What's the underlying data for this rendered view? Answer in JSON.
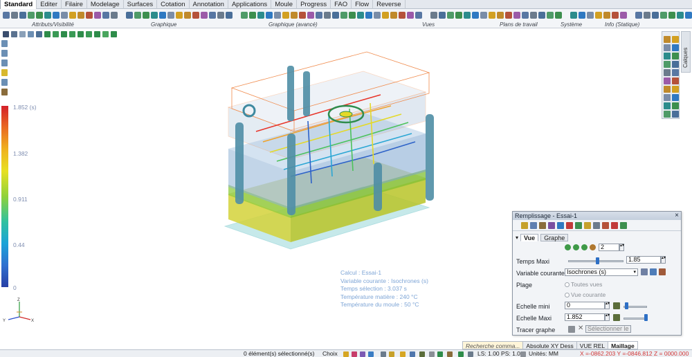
{
  "ribbon": {
    "tabs": [
      "Standard",
      "Editer",
      "Filaire",
      "Modelage",
      "Surfaces",
      "Cotation",
      "Annotation",
      "Applications",
      "Moule",
      "Progress",
      "FAO",
      "Flow",
      "Reverse"
    ],
    "active_tab": "Standard",
    "groups": [
      "Attributs/Visibilité",
      "Graphique",
      "Graphique (avancé)",
      "Vues",
      "Plans de travail",
      "Système",
      "Info (Statique)"
    ]
  },
  "legend": {
    "max_label": "1.852 (s)",
    "labels": [
      "1.382",
      "0.911",
      "0.44",
      "0"
    ]
  },
  "triad": {
    "x": "X",
    "y": "Y",
    "z": "Z"
  },
  "model_info": {
    "line1": "Calcul : Essai-1",
    "line2": "Variable courante : Isochrones (s)",
    "line3": "Temps sélection : 3.037 s",
    "line4": "Température matière : 240 °C",
    "line5": "Température du moule : 50 °C"
  },
  "right_panel": {
    "tab_label": "Calques"
  },
  "panel": {
    "title": "Remplissage - Essai-1",
    "close": "×",
    "tabs": [
      "Vue",
      "Graphe"
    ],
    "active_tab": "Vue",
    "count_value": "2",
    "temps_maxi_label": "Temps Maxi",
    "temps_maxi_value": "1.85",
    "variable_label": "Variable courante",
    "variable_value": "Isochrones (s)",
    "plage_label": "Plage",
    "plage_opt1": "Toutes vues",
    "plage_opt2": "Vue courante",
    "echelle_mini_label": "Echelle mini",
    "echelle_mini_value": "0",
    "echelle_maxi_label": "Echelle Maxi",
    "echelle_maxi_value": "1.852",
    "tracer_label": "Tracer graphe",
    "select_placeholder": "Sélectionner le"
  },
  "statusbar": {
    "search_placeholder": "Recherche comma...",
    "view_tabs": [
      "Absolute XY Dess",
      "VUE REL",
      "Maillage"
    ],
    "active_view_tab": "Maillage",
    "selected": "0 élément(s) sélectionné(s)",
    "choice": "Choix",
    "ls_ps": "LS: 1.00 PS: 1.00",
    "units": "Unités: MM",
    "coords": "X =-0862.203 Y =-0846.812 Z = 0000.000"
  },
  "colors": {
    "accent": "#2d6fc5",
    "coords_text": "#d23737"
  }
}
